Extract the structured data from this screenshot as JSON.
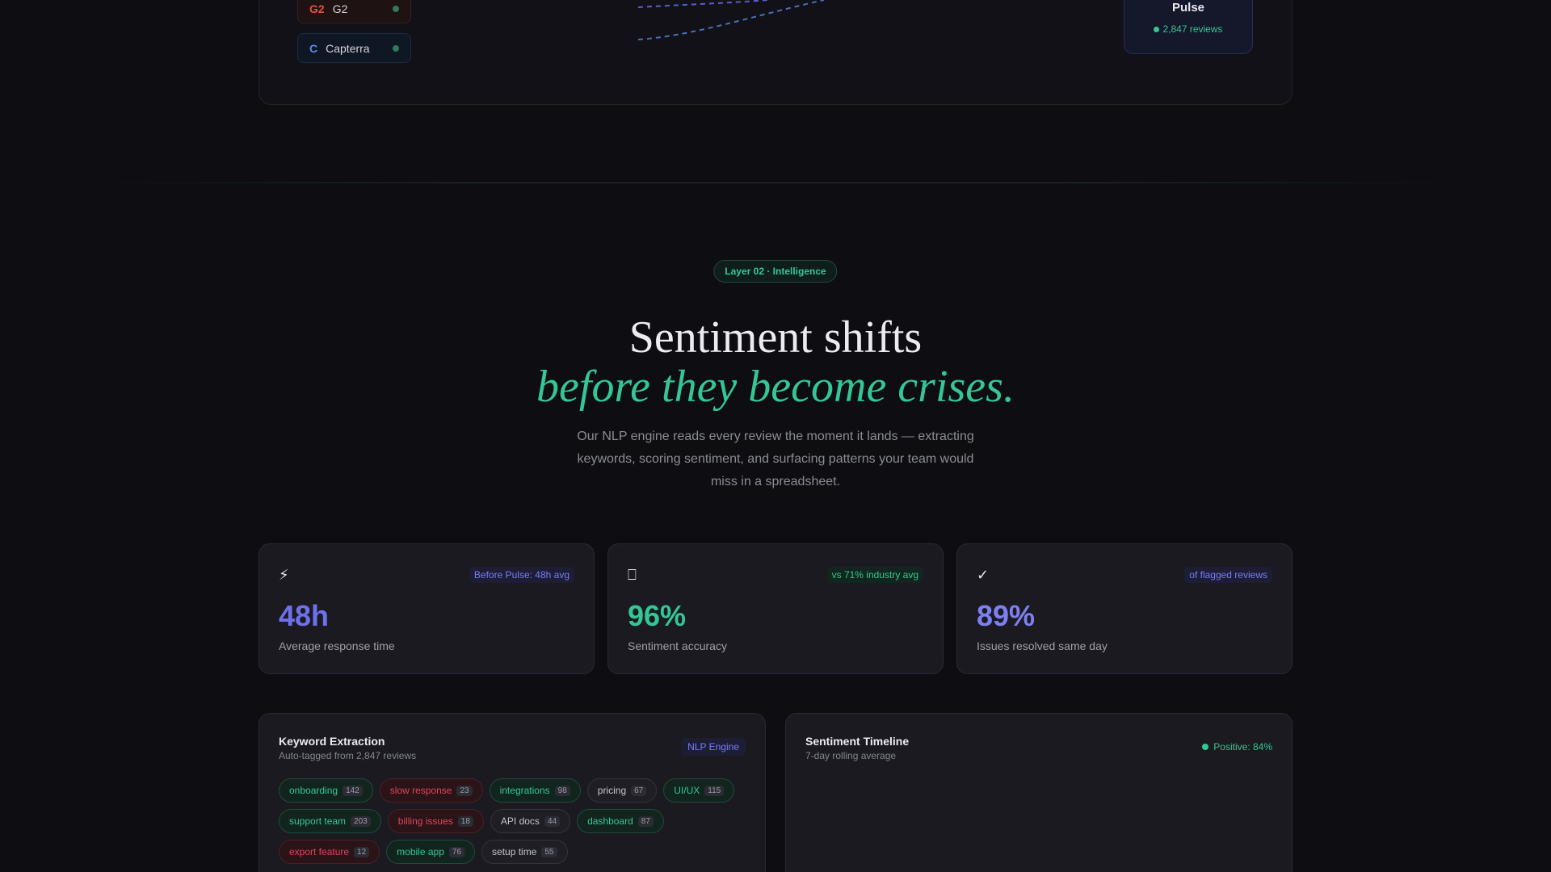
{
  "sources": [
    {
      "abbr": "G2",
      "name": "G2"
    },
    {
      "abbr": "C",
      "name": "Capterra"
    }
  ],
  "pulse_card": {
    "title": "Pulse",
    "reviews": "2,847 reviews"
  },
  "hero": {
    "pill": "Layer 02 · Intelligence",
    "title_line1": "Sentiment shifts",
    "title_line2": "before they become crises.",
    "subtitle": "Our NLP engine reads every review the moment it lands — extracting keywords, scoring sentiment, and surfacing patterns your team would miss in a spreadsheet."
  },
  "stats": [
    {
      "icon": "⚡",
      "icon_name": "lightning-icon",
      "badge": "Before Pulse: 48h avg",
      "value": "48h",
      "label": "Average response time"
    },
    {
      "icon": "⎕",
      "icon_name": "target-icon",
      "badge": "vs 71% industry avg",
      "value": "96%",
      "label": "Sentiment accuracy"
    },
    {
      "icon": "✓",
      "icon_name": "check-icon",
      "badge": "of flagged reviews",
      "value": "89%",
      "label": "Issues resolved same day"
    }
  ],
  "keyword_panel": {
    "title": "Keyword Extraction",
    "subtitle": "Auto-tagged from 2,847 reviews",
    "badge": "NLP Engine",
    "tags": [
      {
        "label": "onboarding",
        "count": "142",
        "tone": "pos"
      },
      {
        "label": "slow response",
        "count": "23",
        "tone": "neg"
      },
      {
        "label": "integrations",
        "count": "98",
        "tone": "pos"
      },
      {
        "label": "pricing",
        "count": "67",
        "tone": "neu"
      },
      {
        "label": "UI/UX",
        "count": "115",
        "tone": "pos"
      },
      {
        "label": "support team",
        "count": "203",
        "tone": "pos"
      },
      {
        "label": "billing issues",
        "count": "18",
        "tone": "neg"
      },
      {
        "label": "API docs",
        "count": "44",
        "tone": "neu"
      },
      {
        "label": "dashboard",
        "count": "87",
        "tone": "pos"
      },
      {
        "label": "export feature",
        "count": "12",
        "tone": "neg"
      },
      {
        "label": "mobile app",
        "count": "76",
        "tone": "pos"
      },
      {
        "label": "setup time",
        "count": "55",
        "tone": "neu"
      }
    ]
  },
  "timeline_panel": {
    "title": "Sentiment Timeline",
    "subtitle": "7-day rolling average",
    "positive": "Positive: 84%"
  },
  "colors": {
    "accent_green": "#34c795",
    "accent_violet": "#6f71ec",
    "negative": "#e0455c"
  }
}
